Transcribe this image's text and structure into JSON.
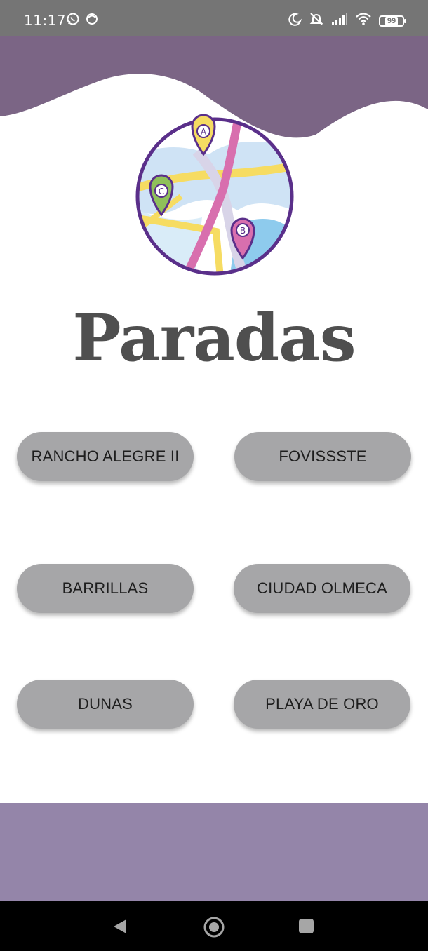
{
  "status_bar": {
    "time": "11:17",
    "battery": "99",
    "left_icons": [
      "whatsapp-icon",
      "notification-icon"
    ],
    "right_icons": [
      "moon-icon",
      "mute-icon",
      "signal-icon",
      "wifi-icon",
      "battery-icon"
    ]
  },
  "header": {
    "title": "Paradas"
  },
  "logo": {
    "markers": [
      "A",
      "B",
      "C"
    ]
  },
  "stops": [
    {
      "label": "RANCHO ALEGRE II"
    },
    {
      "label": "FOVISSSTE"
    },
    {
      "label": "BARRILLAS"
    },
    {
      "label": "CIUDAD OLMECA"
    },
    {
      "label": "DUNAS"
    },
    {
      "label": "PLAYA DE ORO"
    }
  ],
  "nav": {
    "icons": [
      "back-icon",
      "home-icon",
      "recents-icon"
    ]
  },
  "colors": {
    "status_bar": "#757575",
    "header": "#7b6585",
    "button": "#a6a6a8",
    "footer": "#9485a9",
    "title": "#4f4f4f"
  }
}
